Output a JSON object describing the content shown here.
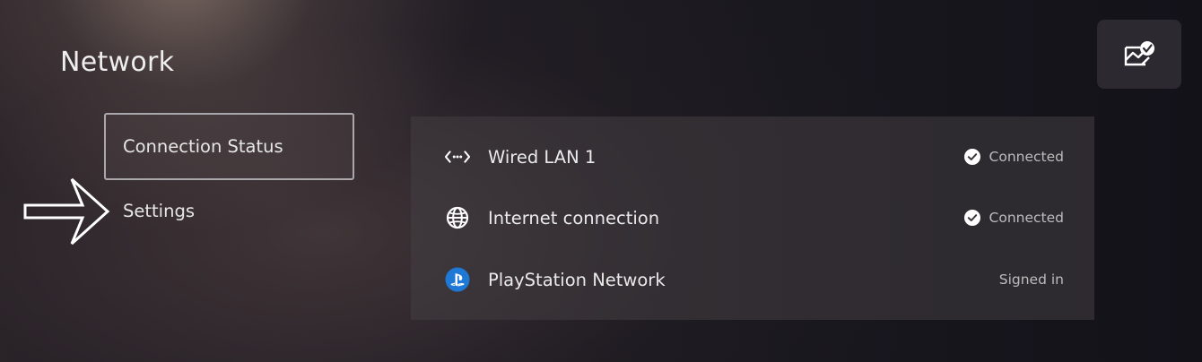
{
  "page": {
    "title": "Network"
  },
  "menu": {
    "items": [
      {
        "label": "Connection Status",
        "selected": true
      },
      {
        "label": "Settings",
        "selected": false
      }
    ]
  },
  "status": {
    "rows": [
      {
        "icon": "wired-lan-icon",
        "label": "Wired LAN 1",
        "status": "Connected",
        "status_icon": "check-circle-icon"
      },
      {
        "icon": "globe-icon",
        "label": "Internet connection",
        "status": "Connected",
        "status_icon": "check-circle-icon"
      },
      {
        "icon": "playstation-icon",
        "label": "PlayStation Network",
        "status": "Signed in",
        "status_icon": ""
      }
    ]
  },
  "corner_button": {
    "icon": "network-check-icon"
  },
  "pointer": {
    "icon": "right-arrow-icon"
  },
  "colors": {
    "playstation_blue": "#1d78d6",
    "text_primary": "#eaeaea",
    "text_secondary": "#bcbcbc"
  }
}
